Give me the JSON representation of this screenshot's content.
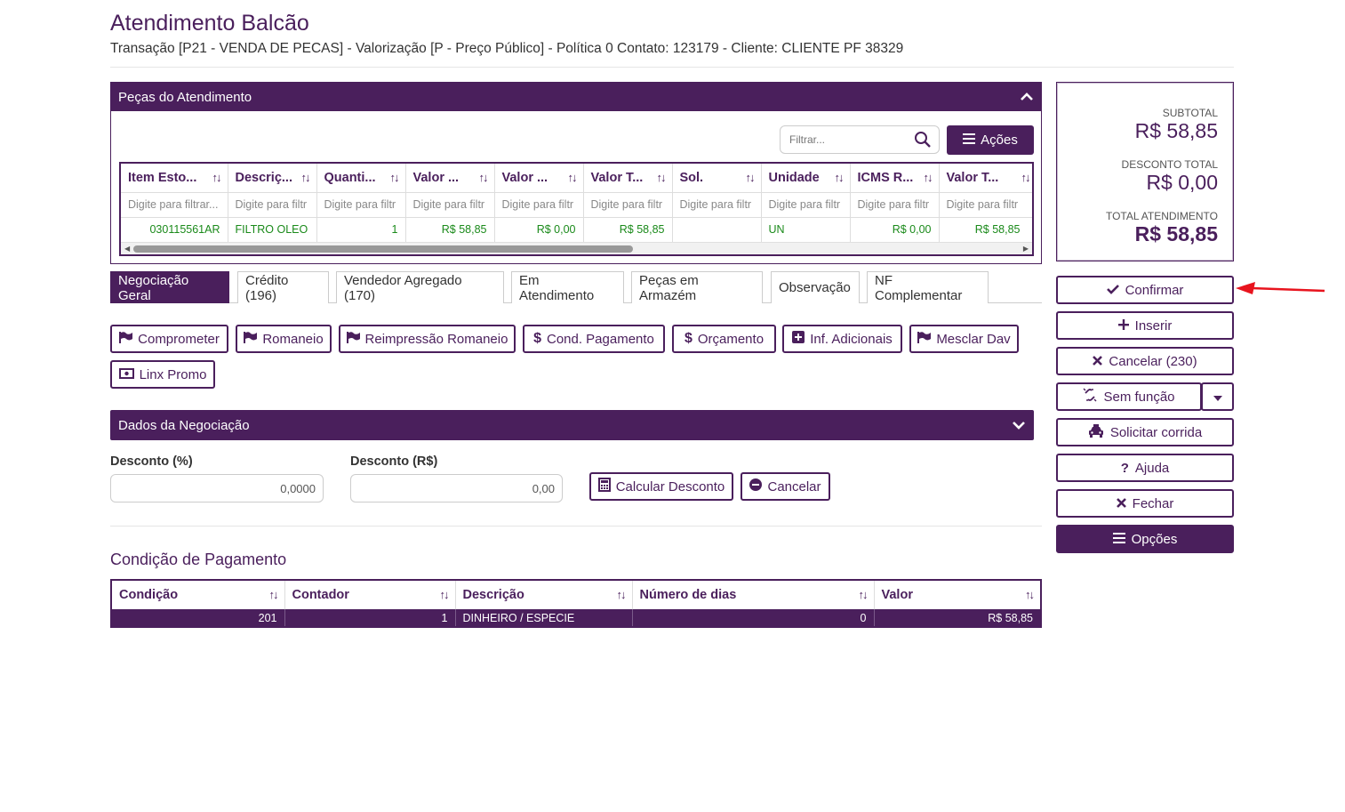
{
  "header": {
    "title": "Atendimento Balcão",
    "subtitle": "Transação [P21 - VENDA DE PECAS] - Valorização [P - Preço Público] - Política 0 Contato: 123179 - Cliente: CLIENTE PF 38329"
  },
  "pecas": {
    "title": "Peças do Atendimento",
    "filter_placeholder": "Filtrar...",
    "acoes_label": "Ações",
    "columns": [
      "Item Esto...",
      "Descriç...",
      "Quanti...",
      "Valor ...",
      "Valor ...",
      "Valor T...",
      "Sol.",
      "Unidade",
      "ICMS R...",
      "Valor T..."
    ],
    "filter_row": [
      "Digite para filtrar...",
      "Digite para filtr",
      "Digite para filtr",
      "Digite para filtr",
      "Digite para filtr",
      "Digite para filtr",
      "Digite para filtr",
      "Digite para filtr",
      "Digite para filtr",
      "Digite para filtr"
    ],
    "rows": [
      [
        "030115561AR",
        "FILTRO OLEO",
        "1",
        "R$ 58,85",
        "R$ 0,00",
        "R$ 58,85",
        "",
        "UN",
        "R$ 0,00",
        "R$ 58,85"
      ]
    ]
  },
  "tabs": [
    {
      "label": "Negociação Geral",
      "active": true
    },
    {
      "label": "Crédito (196)"
    },
    {
      "label": "Vendedor Agregado (170)"
    },
    {
      "label": "Em Atendimento"
    },
    {
      "label": "Peças em Armazém"
    },
    {
      "label": "Observação"
    },
    {
      "label": "NF Complementar"
    }
  ],
  "actions": {
    "comprometer": "Comprometer",
    "romaneio": "Romaneio",
    "reimpressao": "Reimpressão Romaneio",
    "cond_pagamento": "Cond. Pagamento",
    "orcamento": "Orçamento",
    "inf_adicionais": "Inf. Adicionais",
    "mesclar_dav": "Mesclar Dav",
    "linx_promo": "Linx Promo"
  },
  "dados": {
    "title": "Dados da Negociação",
    "desconto_pct_label": "Desconto (%)",
    "desconto_pct_value": "0,0000",
    "desconto_rs_label": "Desconto (R$)",
    "desconto_rs_value": "0,00",
    "calcular_label": "Calcular Desconto",
    "cancelar_label": "Cancelar"
  },
  "pagamento": {
    "title": "Condição de Pagamento",
    "columns": [
      "Condição",
      "Contador",
      "Descrição",
      "Número de dias",
      "Valor"
    ],
    "rows": [
      [
        "201",
        "1",
        "DINHEIRO / ESPECIE",
        "0",
        "R$ 58,85"
      ]
    ]
  },
  "totals": {
    "subtotal_label": "SUBTOTAL",
    "subtotal_value": "R$ 58,85",
    "desconto_label": "DESCONTO TOTAL",
    "desconto_value": "R$ 0,00",
    "total_label": "TOTAL ATENDIMENTO",
    "total_value": "R$ 58,85"
  },
  "side_buttons": {
    "confirmar": "Confirmar",
    "inserir": "Inserir",
    "cancelar": "Cancelar (230)",
    "sem_funcao": "Sem função",
    "solicitar_corrida": "Solicitar corrida",
    "ajuda": "Ajuda",
    "fechar": "Fechar",
    "opcoes": "Opções"
  },
  "colors": {
    "primary": "#4a1f5c",
    "value_green": "#1a8a1a",
    "arrow": "#e8141e"
  }
}
